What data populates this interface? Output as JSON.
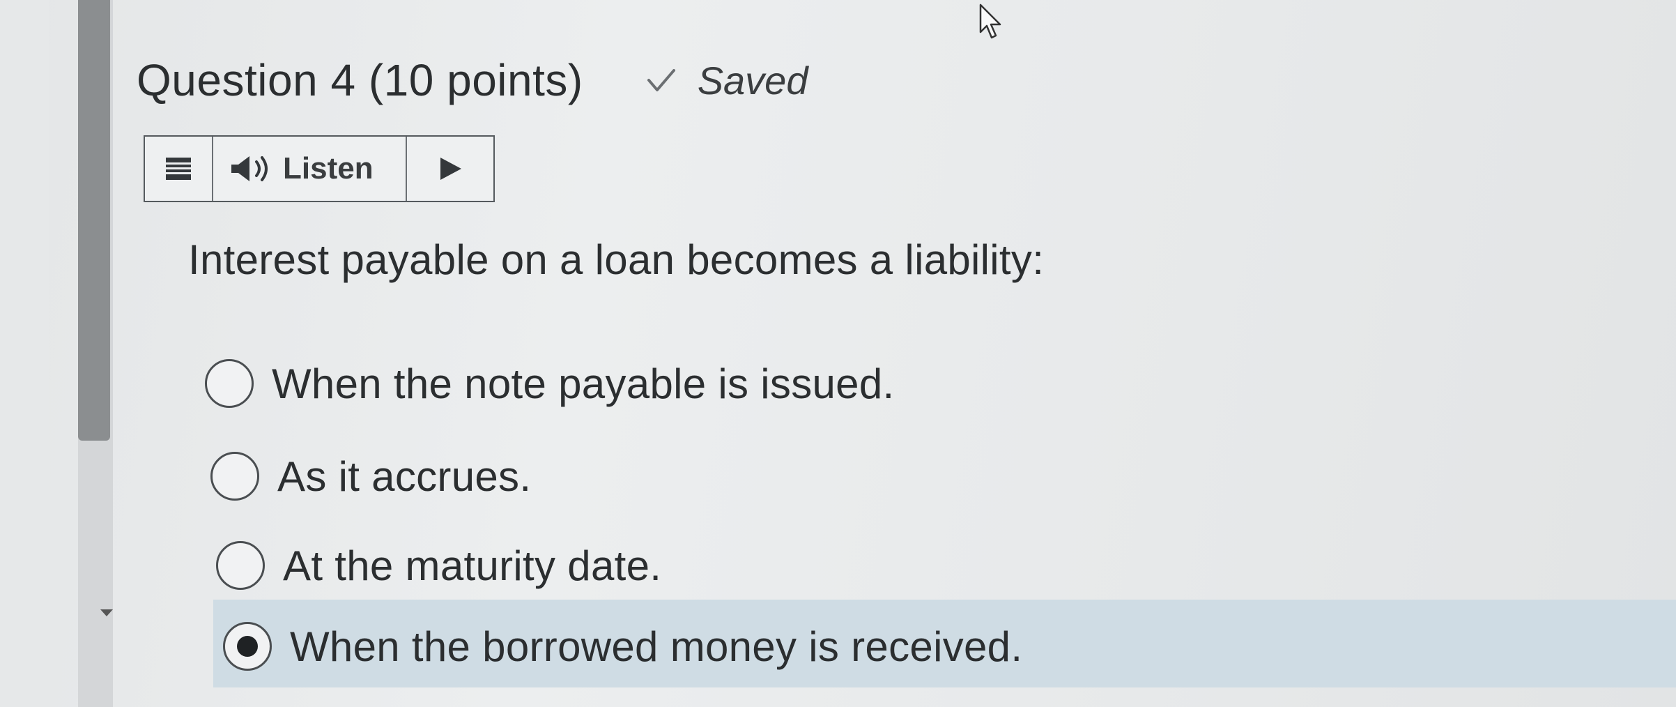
{
  "question": {
    "title": "Question 4 (10 points)",
    "status_text": "Saved"
  },
  "listen_toolbar": {
    "label": "Listen"
  },
  "prompt": "Interest payable on a loan becomes a liability:",
  "options": [
    {
      "label": "When the note payable is issued.",
      "selected": false
    },
    {
      "label": "As it accrues.",
      "selected": false
    },
    {
      "label": "At the maturity date.",
      "selected": false
    },
    {
      "label": "When the borrowed money is received.",
      "selected": true
    }
  ],
  "colors": {
    "selected_highlight": "#cfdce4",
    "text": "#2b2e30"
  }
}
